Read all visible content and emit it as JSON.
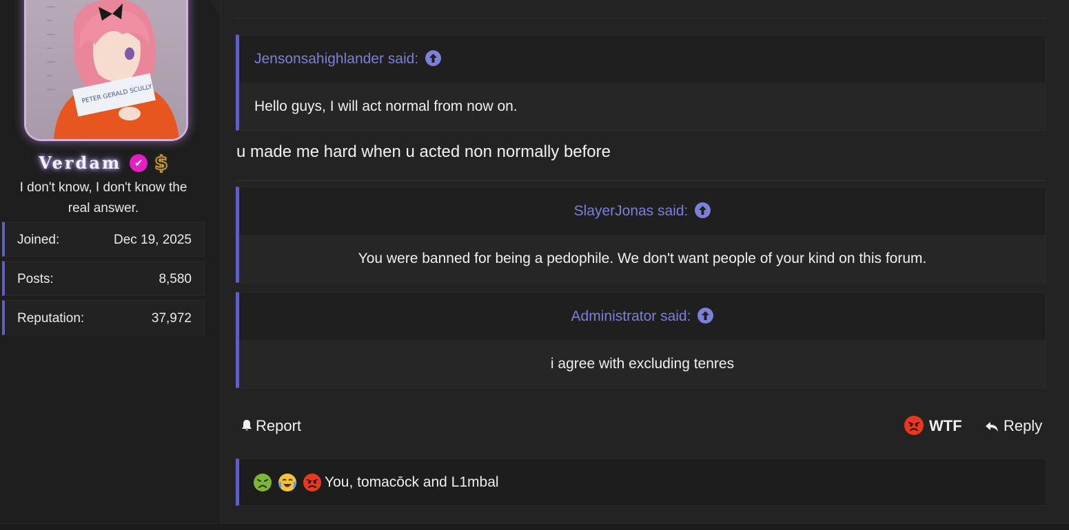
{
  "user": {
    "name": "Verdam",
    "title": "I don't know, I don't know the real answer.",
    "title_line1": "I don't know, I don't know the",
    "title_line2": "real answer.",
    "avatar_sign_text": "PETER GERALD SCULLY",
    "stats": [
      {
        "label": "Joined:",
        "value": "Dec 19, 2025"
      },
      {
        "label": "Posts:",
        "value": "8,580"
      },
      {
        "label": "Reputation:",
        "value": "37,972"
      }
    ]
  },
  "post": {
    "quotes": [
      {
        "author": "Jensonsahighlander said:",
        "text": "Hello guys, I will act normal from now on."
      },
      {
        "author": "SlayerJonas said:",
        "text": "You were banned for being a pedophile. We don't want people of your kind on this forum."
      },
      {
        "author": "Administrator said:",
        "text": "i agree with excluding tenres"
      }
    ],
    "body": "u made me hard when u acted non normally before",
    "actions": {
      "report": "Report",
      "reaction": "WTF",
      "reply": "Reply"
    },
    "reactions_text": "You, tomacōck and L1mbal"
  },
  "colors": {
    "accent": "#5f5fc4",
    "quote_author": "#7b80d9",
    "verified_badge": "#e61fc4",
    "angry_reaction": "#e8391e"
  },
  "icons": [
    "verified-icon",
    "dollar-icon",
    "arrow-up-circle-icon",
    "bell-icon",
    "angry-face-icon",
    "reply-arrow-icon",
    "nauseated-face-icon",
    "crying-laughing-face-icon"
  ]
}
